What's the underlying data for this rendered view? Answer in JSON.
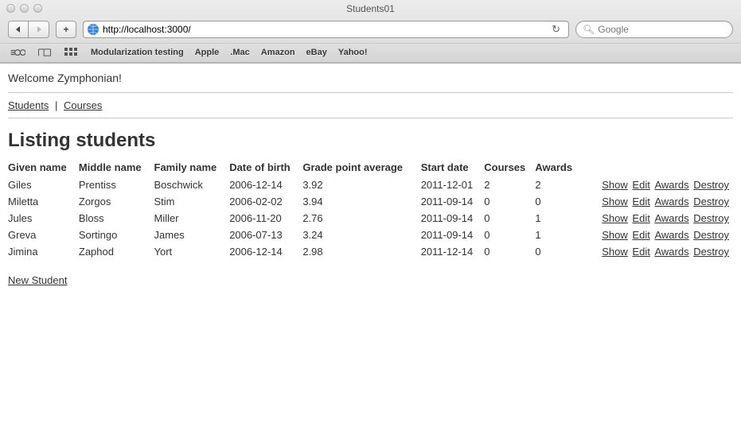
{
  "browser": {
    "windowTitle": "Students01",
    "url": "http://localhost:3000/",
    "searchPlaceholder": "Google",
    "bookmarks": [
      "Modularization testing",
      "Apple",
      ".Mac",
      "Amazon",
      "eBay",
      "Yahoo!"
    ]
  },
  "page": {
    "welcome": "Welcome Zymphonian!",
    "nav": {
      "students": "Students",
      "courses": "Courses",
      "sep": "|"
    },
    "heading": "Listing students",
    "columns": [
      "Given name",
      "Middle name",
      "Family name",
      "Date of birth",
      "Grade point average",
      "Start date",
      "Courses",
      "Awards"
    ],
    "actions": {
      "show": "Show",
      "edit": "Edit",
      "awards": "Awards",
      "destroy": "Destroy"
    },
    "newStudent": "New Student",
    "rows": [
      {
        "given": "Giles",
        "middle": "Prentiss",
        "family": "Boschwick",
        "dob": "2006-12-14",
        "gpa": "3.92",
        "start": "2011-12-01",
        "courses": "2",
        "awards": "2"
      },
      {
        "given": "Miletta",
        "middle": "Zorgos",
        "family": "Stim",
        "dob": "2006-02-02",
        "gpa": "3.94",
        "start": "2011-09-14",
        "courses": "0",
        "awards": "0"
      },
      {
        "given": "Jules",
        "middle": "Bloss",
        "family": "Miller",
        "dob": "2006-11-20",
        "gpa": "2.76",
        "start": "2011-09-14",
        "courses": "0",
        "awards": "1"
      },
      {
        "given": "Greva",
        "middle": "Sortingo",
        "family": "James",
        "dob": "2006-07-13",
        "gpa": "3.24",
        "start": "2011-09-14",
        "courses": "0",
        "awards": "1"
      },
      {
        "given": "Jimina",
        "middle": "Zaphod",
        "family": "Yort",
        "dob": "2006-12-14",
        "gpa": "2.98",
        "start": "2011-12-14",
        "courses": "0",
        "awards": "0"
      }
    ]
  }
}
